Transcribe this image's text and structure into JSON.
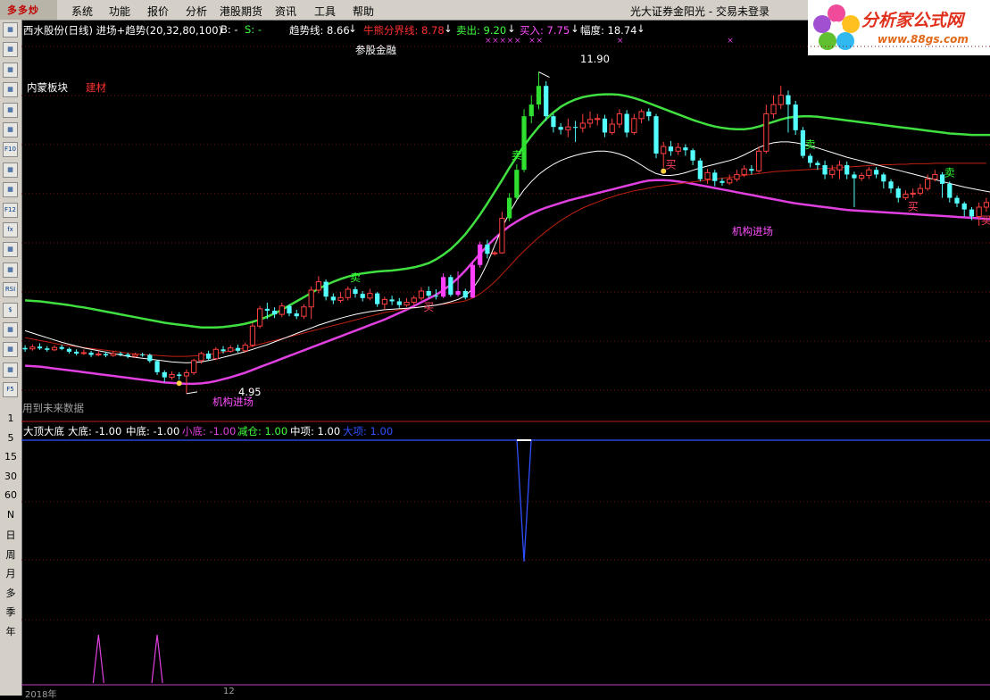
{
  "menubar": {
    "logo_text": "多多炒",
    "items": [
      "系统",
      "功能",
      "报价",
      "分析",
      "港股期货",
      "资讯",
      "工具",
      "帮助"
    ],
    "status": "光大证券金阳光 - 交易未登录"
  },
  "brand": {
    "name": "分析家公式网",
    "url": "www.88gs.com"
  },
  "toolbar": {
    "icons": [
      "page-icon",
      "table-icon",
      "line-chart-icon",
      "kline-icon",
      "multi-window-icon",
      "list-icon",
      "f10-icon",
      "notes-icon",
      "calculator-icon",
      "f12-icon",
      "formula-icon",
      "search-icon",
      "wave-icon",
      "rsi-icon",
      "money-icon",
      "move-icon",
      "export-icon",
      "pencil-icon",
      "f5-icon"
    ],
    "labels": [
      "",
      "",
      "",
      "",
      "",
      "",
      "F10",
      "",
      "",
      "F12",
      "fx",
      "",
      "",
      "RSI",
      "$",
      "",
      "",
      "",
      "F5"
    ],
    "periods": [
      "1",
      "5",
      "15",
      "30",
      "60",
      "N",
      "日",
      "周",
      "月",
      "多",
      "季",
      "年"
    ]
  },
  "main_panel": {
    "stock_title": "西水股份(日线) 进场+趋势(20,32,80,100)",
    "b_label": "B: -",
    "s_label": "S: -",
    "trend_line": "趋势线: 8.66",
    "bull_bear": "牛熊分界线: 8.78",
    "sell": "卖出: 9.20",
    "buy": "买入: 7.75",
    "amplitude": "幅度: 18.74",
    "sector_name": "内蒙板块",
    "industry": "建材",
    "concept": "参股金融",
    "high_price": "11.90",
    "low_price": "4.95",
    "jigou_label": "机构进场",
    "sell_marker": "卖",
    "buy_marker": "买",
    "future_data_note": "用到未来数据"
  },
  "sub_panel": {
    "title": "大顶大底",
    "fields": [
      "大底: -1.00",
      "中底: -1.00",
      "小底: -1.00",
      "减仓: 1.00",
      "中项: 1.00",
      "大项: 1.00"
    ],
    "colors": [
      "#ffffff",
      "#ffffff",
      "#e040e0",
      "#40ff40",
      "#ffffff",
      "#3050ff"
    ]
  },
  "date_axis": {
    "first_label": "2018年",
    "second_label": "12"
  },
  "colors": {
    "up": "#ff4040",
    "down": "#54ffff",
    "signal": "#ff40ff",
    "green_band": "#40e040",
    "magenta_band": "#e040e0",
    "white_line": "#ffffff",
    "red_line": "#c02010",
    "grid": "#7a1010"
  },
  "chart_data": {
    "type": "candlestick",
    "y_range": [
      4.5,
      12.6
    ],
    "high": 11.9,
    "low": 4.95,
    "candles": [
      [
        5.98,
        5.95,
        6.04,
        5.9
      ],
      [
        5.96,
        6.0,
        6.06,
        5.92
      ],
      [
        6.01,
        5.97,
        6.08,
        5.94
      ],
      [
        5.97,
        5.94,
        6.02,
        5.9
      ],
      [
        5.94,
        5.99,
        6.04,
        5.91
      ],
      [
        6.0,
        5.96,
        6.05,
        5.93
      ],
      [
        5.96,
        5.9,
        5.99,
        5.86
      ],
      [
        5.9,
        5.86,
        5.95,
        5.82
      ],
      [
        5.86,
        5.88,
        5.95,
        5.83
      ],
      [
        5.88,
        5.83,
        5.92,
        5.78
      ],
      [
        5.83,
        5.85,
        5.92,
        5.8
      ],
      [
        5.85,
        5.82,
        5.9,
        5.78
      ],
      [
        5.82,
        5.86,
        5.92,
        5.79
      ],
      [
        5.86,
        5.84,
        5.9,
        5.8
      ],
      [
        5.84,
        5.8,
        5.88,
        5.76
      ],
      [
        5.8,
        5.84,
        5.88,
        5.77
      ],
      [
        5.84,
        5.83,
        5.88,
        5.79
      ],
      [
        5.83,
        5.7,
        5.86,
        5.66
      ],
      [
        5.7,
        5.46,
        5.72,
        5.4
      ],
      [
        5.46,
        5.35,
        5.5,
        5.25
      ],
      [
        5.35,
        5.41,
        5.48,
        5.3
      ],
      [
        5.41,
        5.38,
        5.46,
        5.3
      ],
      [
        5.38,
        5.45,
        5.52,
        5.0
      ],
      [
        5.45,
        5.71,
        5.75,
        5.4
      ],
      [
        5.71,
        5.86,
        5.9,
        5.64
      ],
      [
        5.86,
        5.75,
        5.92,
        5.7
      ],
      [
        5.75,
        5.95,
        6.0,
        5.72
      ],
      [
        5.95,
        5.91,
        6.02,
        5.86
      ],
      [
        5.91,
        5.98,
        6.04,
        5.88
      ],
      [
        5.98,
        5.92,
        6.05,
        5.88
      ],
      [
        5.92,
        6.04,
        6.1,
        5.88
      ],
      [
        6.04,
        6.45,
        6.52,
        6.0
      ],
      [
        6.45,
        6.82,
        6.88,
        6.4
      ],
      [
        6.82,
        6.78,
        6.95,
        6.6
      ],
      [
        6.78,
        6.7,
        6.85,
        6.62
      ],
      [
        6.7,
        6.88,
        6.95,
        6.64
      ],
      [
        6.88,
        6.72,
        6.92,
        6.66
      ],
      [
        6.72,
        6.66,
        6.8,
        6.6
      ],
      [
        6.66,
        6.86,
        6.92,
        6.6
      ],
      [
        6.86,
        7.22,
        7.3,
        6.6
      ],
      [
        7.22,
        7.4,
        7.52,
        7.15
      ],
      [
        7.4,
        7.08,
        7.45,
        7.0
      ],
      [
        7.08,
        7.0,
        7.15,
        6.92
      ],
      [
        7.0,
        7.06,
        7.18,
        6.95
      ],
      [
        7.06,
        7.24,
        7.3,
        7.0
      ],
      [
        7.24,
        7.14,
        7.3,
        7.06
      ],
      [
        7.14,
        7.05,
        7.2,
        6.98
      ],
      [
        7.05,
        7.15,
        7.25,
        7.0
      ],
      [
        7.15,
        6.92,
        7.18,
        6.86
      ],
      [
        6.92,
        7.02,
        7.08,
        6.8
      ],
      [
        7.02,
        6.98,
        7.1,
        6.9
      ],
      [
        6.98,
        6.9,
        7.05,
        6.84
      ],
      [
        6.9,
        6.96,
        7.05,
        6.86
      ],
      [
        6.96,
        7.05,
        7.1,
        6.9
      ],
      [
        7.05,
        7.2,
        7.28,
        7.0
      ],
      [
        7.2,
        7.1,
        7.3,
        7.05
      ],
      [
        7.1,
        7.08,
        7.24,
        7.02
      ],
      [
        7.08,
        7.5,
        7.58,
        7.05
      ],
      [
        7.5,
        7.12,
        7.55,
        7.08
      ],
      [
        7.12,
        7.2,
        7.62,
        7.08
      ],
      [
        7.2,
        7.06,
        7.25,
        7.02
      ],
      [
        7.06,
        7.76,
        7.82,
        7.05
      ],
      [
        7.76,
        8.2,
        8.26,
        7.7
      ],
      [
        8.2,
        8.0,
        8.3,
        7.9
      ],
      [
        8.0,
        8.02,
        8.06,
        7.96
      ],
      [
        8.02,
        8.76,
        8.9,
        8.0
      ],
      [
        8.76,
        9.2,
        9.3,
        8.7
      ],
      [
        9.2,
        9.8,
        9.92,
        9.15
      ],
      [
        9.8,
        10.95,
        11.1,
        9.75
      ],
      [
        10.95,
        11.2,
        11.4,
        10.8
      ],
      [
        11.2,
        11.6,
        11.9,
        11.1
      ],
      [
        11.6,
        10.95,
        11.7,
        10.85
      ],
      [
        10.95,
        10.72,
        11.0,
        10.6
      ],
      [
        10.72,
        10.66,
        10.8,
        10.56
      ],
      [
        10.66,
        10.72,
        10.9,
        10.5
      ],
      [
        10.72,
        10.7,
        10.85,
        10.4
      ],
      [
        10.7,
        10.8,
        11.0,
        10.6
      ],
      [
        10.8,
        10.88,
        11.05,
        10.7
      ],
      [
        10.88,
        10.9,
        11.0,
        10.75
      ],
      [
        10.9,
        10.6,
        10.98,
        10.5
      ],
      [
        10.6,
        10.78,
        10.9,
        10.55
      ],
      [
        10.78,
        11.0,
        11.1,
        10.7
      ],
      [
        11.0,
        10.6,
        11.08,
        10.5
      ],
      [
        10.6,
        10.9,
        11.0,
        10.55
      ],
      [
        10.9,
        11.05,
        11.1,
        10.8
      ],
      [
        11.05,
        10.95,
        11.12,
        10.85
      ],
      [
        10.95,
        10.15,
        11.0,
        10.05
      ],
      [
        10.15,
        10.3,
        10.4,
        9.85
      ],
      [
        10.3,
        10.2,
        10.42,
        10.1
      ],
      [
        10.2,
        10.28,
        10.38,
        10.12
      ],
      [
        10.28,
        10.22,
        10.35,
        10.1
      ],
      [
        10.22,
        10.0,
        10.26,
        9.9
      ],
      [
        10.0,
        9.6,
        10.05,
        9.55
      ],
      [
        9.6,
        9.74,
        9.82,
        9.5
      ],
      [
        9.74,
        9.56,
        9.8,
        9.45
      ],
      [
        9.56,
        9.52,
        9.62,
        9.46
      ],
      [
        9.52,
        9.6,
        9.7,
        9.48
      ],
      [
        9.6,
        9.7,
        9.8,
        9.55
      ],
      [
        9.7,
        9.82,
        9.9,
        9.65
      ],
      [
        9.82,
        9.78,
        9.9,
        9.7
      ],
      [
        9.78,
        10.2,
        10.3,
        9.74
      ],
      [
        10.2,
        11.0,
        11.2,
        10.15
      ],
      [
        11.0,
        11.2,
        11.4,
        10.9
      ],
      [
        11.2,
        11.4,
        11.6,
        11.1
      ],
      [
        11.4,
        11.2,
        11.5,
        10.6
      ],
      [
        11.2,
        10.65,
        11.28,
        10.55
      ],
      [
        10.65,
        10.1,
        10.72,
        10.05
      ],
      [
        10.1,
        9.95,
        10.15,
        9.85
      ],
      [
        9.95,
        9.9,
        10.0,
        9.8
      ],
      [
        9.9,
        9.7,
        10.0,
        9.6
      ],
      [
        9.7,
        9.8,
        9.9,
        9.62
      ],
      [
        9.8,
        9.9,
        10.0,
        9.6
      ],
      [
        9.9,
        9.7,
        9.98,
        9.6
      ],
      [
        9.7,
        9.62,
        9.76,
        9.0
      ],
      [
        9.62,
        9.68,
        9.74,
        9.56
      ],
      [
        9.68,
        9.8,
        9.86,
        9.6
      ],
      [
        9.8,
        9.7,
        9.86,
        9.62
      ],
      [
        9.7,
        9.55,
        9.74,
        9.4
      ],
      [
        9.55,
        9.4,
        9.6,
        9.3
      ],
      [
        9.4,
        9.2,
        9.45,
        9.1
      ],
      [
        9.2,
        9.28,
        9.36,
        9.15
      ],
      [
        9.28,
        9.3,
        9.4,
        9.2
      ],
      [
        9.3,
        9.4,
        9.5,
        9.25
      ],
      [
        9.4,
        9.6,
        9.7,
        9.35
      ],
      [
        9.6,
        9.7,
        9.8,
        9.55
      ],
      [
        9.7,
        9.5,
        9.75,
        9.2
      ],
      [
        9.5,
        9.2,
        9.55,
        9.1
      ],
      [
        9.2,
        9.08,
        9.25,
        9.0
      ],
      [
        9.08,
        8.95,
        9.12,
        8.8
      ],
      [
        8.95,
        8.8,
        9.0,
        8.72
      ],
      [
        8.8,
        9.0,
        9.1,
        8.6
      ],
      [
        9.0,
        9.1,
        9.2,
        8.9
      ]
    ],
    "lines": {
      "green_band": [
        7.0,
        6.99,
        6.98,
        6.96,
        6.94,
        6.92,
        6.9,
        6.87,
        6.85,
        6.82,
        6.79,
        6.76,
        6.73,
        6.7,
        6.67,
        6.64,
        6.61,
        6.58,
        6.55,
        6.52,
        6.5,
        6.48,
        6.46,
        6.44,
        6.42,
        6.42,
        6.42,
        6.43,
        6.45,
        6.47,
        6.5,
        6.54,
        6.59,
        6.65,
        6.72,
        6.8,
        6.89,
        6.98,
        7.07,
        7.16,
        7.25,
        7.33,
        7.4,
        7.46,
        7.51,
        7.55,
        7.58,
        7.6,
        7.62,
        7.63,
        7.64,
        7.66,
        7.68,
        7.71,
        7.75,
        7.8,
        7.88,
        7.98,
        8.1,
        8.25,
        8.42,
        8.62,
        8.84,
        9.08,
        9.33,
        9.58,
        9.84,
        10.08,
        10.32,
        10.53,
        10.72,
        10.89,
        11.03,
        11.15,
        11.24,
        11.31,
        11.36,
        11.39,
        11.41,
        11.42,
        11.42,
        11.41,
        11.38,
        11.34,
        11.29,
        11.23,
        11.17,
        11.11,
        11.05,
        10.99,
        10.93,
        10.87,
        10.82,
        10.77,
        10.73,
        10.7,
        10.68,
        10.67,
        10.67,
        10.69,
        10.73,
        10.78,
        10.83,
        10.88,
        10.92,
        10.94,
        10.95,
        10.95,
        10.94,
        10.92,
        10.9,
        10.88,
        10.86,
        10.84,
        10.82,
        10.8,
        10.78,
        10.76,
        10.74,
        10.72,
        10.7,
        10.68,
        10.66,
        10.64,
        10.62,
        10.6,
        10.58,
        10.57,
        10.56,
        10.55,
        10.55,
        10.55,
        10.55
      ],
      "white_line": [
        6.35,
        6.3,
        6.25,
        6.2,
        6.15,
        6.1,
        6.06,
        6.02,
        5.98,
        5.95,
        5.92,
        5.89,
        5.86,
        5.83,
        5.8,
        5.78,
        5.76,
        5.74,
        5.72,
        5.7,
        5.68,
        5.67,
        5.66,
        5.67,
        5.68,
        5.71,
        5.74,
        5.78,
        5.82,
        5.86,
        5.9,
        5.95,
        6.0,
        6.05,
        6.11,
        6.17,
        6.23,
        6.29,
        6.35,
        6.41,
        6.47,
        6.52,
        6.57,
        6.62,
        6.66,
        6.7,
        6.73,
        6.76,
        6.78,
        6.8,
        6.81,
        6.82,
        6.83,
        6.84,
        6.86,
        6.88,
        6.9,
        6.93,
        6.97,
        7.02,
        7.1,
        7.25,
        7.48,
        7.8,
        8.18,
        8.55,
        8.88,
        9.15,
        9.37,
        9.55,
        9.7,
        9.82,
        9.92,
        10.0,
        10.06,
        10.11,
        10.15,
        10.18,
        10.2,
        10.2,
        10.18,
        10.14,
        10.08,
        10.0,
        9.9,
        9.8,
        9.72,
        9.68,
        9.68,
        9.7,
        9.74,
        9.79,
        9.84,
        9.88,
        9.92,
        9.96,
        10.0,
        10.05,
        10.12,
        10.2,
        10.28,
        10.34,
        10.38,
        10.4,
        10.4,
        10.38,
        10.35,
        10.31,
        10.27,
        10.22,
        10.17,
        10.12,
        10.07,
        10.03,
        9.99,
        9.95,
        9.91,
        9.87,
        9.83,
        9.79,
        9.75,
        9.71,
        9.67,
        9.63,
        9.59,
        9.55,
        9.51,
        9.47,
        9.43,
        9.4,
        9.37,
        9.34,
        9.31,
        9.28
      ],
      "red_line": [
        6.2,
        6.17,
        6.14,
        6.11,
        6.08,
        6.05,
        6.03,
        6.01,
        5.99,
        5.97,
        5.95,
        5.93,
        5.91,
        5.89,
        5.87,
        5.85,
        5.84,
        5.83,
        5.82,
        5.81,
        5.8,
        5.8,
        5.8,
        5.81,
        5.82,
        5.84,
        5.86,
        5.89,
        5.92,
        5.95,
        5.98,
        6.02,
        6.06,
        6.1,
        6.14,
        6.18,
        6.22,
        6.26,
        6.3,
        6.34,
        6.38,
        6.42,
        6.46,
        6.5,
        6.54,
        6.58,
        6.62,
        6.66,
        6.7,
        6.74,
        6.77,
        6.8,
        6.82,
        6.84,
        6.86,
        6.88,
        6.9,
        6.92,
        6.94,
        6.96,
        6.99,
        7.05,
        7.14,
        7.26,
        7.4,
        7.56,
        7.73,
        7.9,
        8.06,
        8.21,
        8.35,
        8.48,
        8.6,
        8.71,
        8.81,
        8.9,
        8.98,
        9.05,
        9.11,
        9.17,
        9.22,
        9.27,
        9.31,
        9.35,
        9.38,
        9.41,
        9.44,
        9.46,
        9.48,
        9.5,
        9.52,
        9.54,
        9.56,
        9.58,
        9.6,
        9.62,
        9.64,
        9.66,
        9.68,
        9.7,
        9.72,
        9.74,
        9.76,
        9.77,
        9.78,
        9.79,
        9.8,
        9.81,
        9.82,
        9.83,
        9.84,
        9.85,
        9.86,
        9.87,
        9.88,
        9.89,
        9.9,
        9.91,
        9.91,
        9.92,
        9.92,
        9.93,
        9.93,
        9.93,
        9.94,
        9.94,
        9.94,
        9.94,
        9.94,
        9.94,
        9.94,
        9.94
      ],
      "magenta_band": [
        5.6,
        5.59,
        5.58,
        5.56,
        5.54,
        5.52,
        5.5,
        5.48,
        5.46,
        5.44,
        5.42,
        5.4,
        5.38,
        5.36,
        5.34,
        5.32,
        5.3,
        5.28,
        5.26,
        5.24,
        5.23,
        5.22,
        5.21,
        5.21,
        5.22,
        5.24,
        5.27,
        5.31,
        5.35,
        5.4,
        5.45,
        5.51,
        5.57,
        5.63,
        5.69,
        5.75,
        5.81,
        5.87,
        5.93,
        5.99,
        6.05,
        6.11,
        6.17,
        6.23,
        6.29,
        6.35,
        6.41,
        6.47,
        6.53,
        6.59,
        6.66,
        6.73,
        6.8,
        6.88,
        6.96,
        7.04,
        7.12,
        7.22,
        7.34,
        7.48,
        7.64,
        7.82,
        8.0,
        8.17,
        8.33,
        8.47,
        8.59,
        8.69,
        8.78,
        8.86,
        8.93,
        8.99,
        9.04,
        9.09,
        9.14,
        9.18,
        9.22,
        9.26,
        9.3,
        9.34,
        9.38,
        9.42,
        9.46,
        9.5,
        9.54,
        9.57,
        9.58,
        9.58,
        9.57,
        9.55,
        9.53,
        9.5,
        9.47,
        9.44,
        9.41,
        9.38,
        9.35,
        9.32,
        9.29,
        9.26,
        9.23,
        9.2,
        9.17,
        9.14,
        9.11,
        9.08,
        9.06,
        9.04,
        9.02,
        9.0,
        8.98,
        8.96,
        8.94,
        8.93,
        8.92,
        8.91,
        8.9,
        8.89,
        8.88,
        8.87,
        8.86,
        8.85,
        8.84,
        8.83,
        8.82,
        8.81,
        8.8,
        8.79,
        8.78,
        8.77,
        8.76,
        8.75,
        8.74,
        8.73
      ]
    },
    "signals": {
      "jigou_entry": [
        21,
        87
      ],
      "buy_marks": [
        45,
        67,
        107,
        126
      ],
      "sell_marks": [
        40,
        68,
        110,
        132
      ],
      "red_buy_markers": [
        55,
        88,
        121,
        131
      ],
      "pink_bars": [
        57,
        59,
        61,
        62
      ]
    },
    "sub_panel_peaks": [
      10,
      18
    ],
    "sub_panel_blue_dip": 68
  }
}
